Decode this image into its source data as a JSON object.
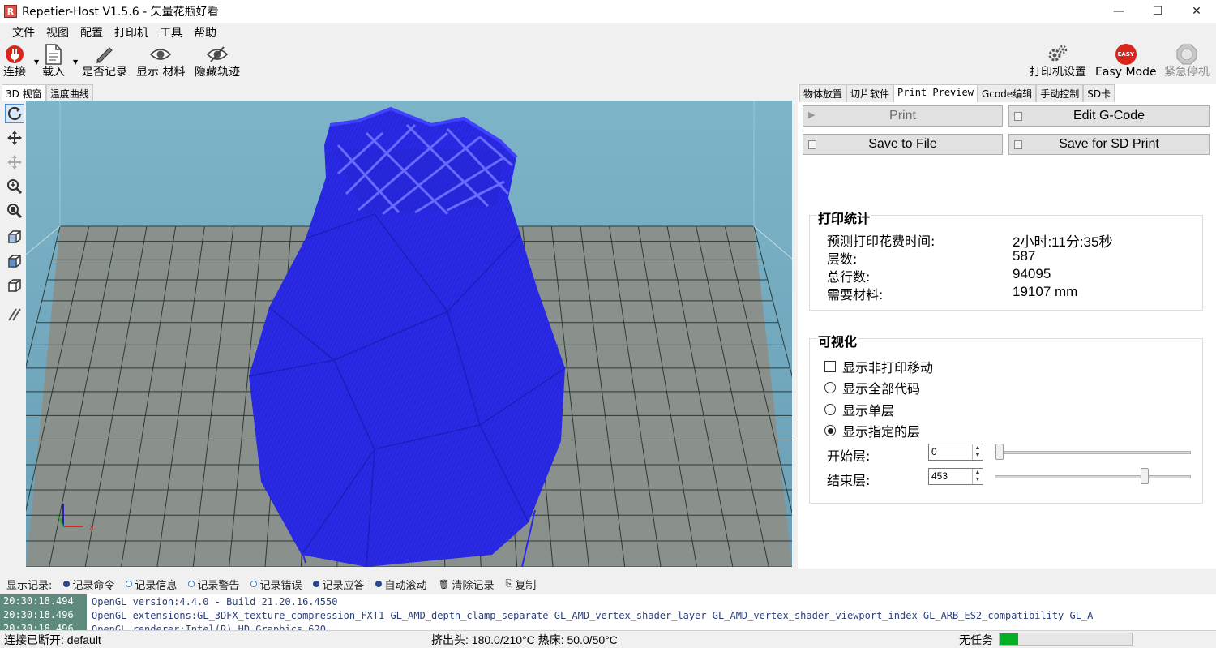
{
  "window": {
    "title": "Repetier-Host V1.5.6 - 矢量花瓶好看",
    "app_icon": "R",
    "controls": {
      "minimize": "—",
      "maximize": "☐",
      "close": "✕"
    }
  },
  "menu": [
    "文件",
    "视图",
    "配置",
    "打印机",
    "工具",
    "帮助"
  ],
  "toolbar": {
    "connect": "连接",
    "load": "载入",
    "log_toggle": "是否记录",
    "show_material": "显示 材料",
    "hide_travel": "隐藏轨迹",
    "printer_settings": "打印机设置",
    "easy_mode": "Easy Mode",
    "easy_badge": "EASY",
    "emergency_stop": "紧急停机"
  },
  "left_tabs": [
    "3D 视窗",
    "温度曲线"
  ],
  "right_tabs": [
    "物体放置",
    "切片软件",
    "Print Preview",
    "Gcode编辑",
    "手动控制",
    "SD卡"
  ],
  "preview": {
    "print_btn": "Print",
    "edit_gcode_btn": "Edit G-Code",
    "save_file_btn": "Save to File",
    "save_sd_btn": "Save for SD Print",
    "stats": {
      "title": "打印统计",
      "time_label": "预测打印花费时间:",
      "time_value": "2小时:11分:35秒",
      "layers_label": "层数:",
      "layers_value": "587",
      "lines_label": "总行数:",
      "lines_value": "94095",
      "material_label": "需要材料:",
      "material_value": "19107 mm"
    },
    "visual": {
      "title": "可视化",
      "show_travel": "显示非打印移动",
      "show_all": "显示全部代码",
      "show_single": "显示单层",
      "show_range": "显示指定的层",
      "start_label": "开始层:",
      "start_value": "0",
      "end_label": "结束层:",
      "end_value": "453",
      "end_fraction": 0.77
    }
  },
  "log": {
    "label": "显示记录:",
    "options": [
      "记录命令",
      "记录信息",
      "记录警告",
      "记录错误",
      "记录应答",
      "自动滚动"
    ],
    "clear": "清除记录",
    "copy": "复制",
    "rows": [
      {
        "time": "20:30:18.494",
        "msg": "OpenGL version:4.4.0 - Build 21.20.16.4550"
      },
      {
        "time": "20:30:18.496",
        "msg": "OpenGL extensions:GL_3DFX_texture_compression_FXT1 GL_AMD_depth_clamp_separate GL_AMD_vertex_shader_layer GL_AMD_vertex_shader_viewport_index GL_ARB_ES2_compatibility GL_A"
      },
      {
        "time": "20:30:18.496",
        "msg": "OpenGL renderer:Intel(R) HD Graphics 620"
      }
    ]
  },
  "status": {
    "connection": "连接已断开: default",
    "temps": "挤出头: 180.0/210°C 热床: 50.0/50°C",
    "job": "无任务",
    "progress": 0.14
  },
  "colors": {
    "viewport_bg": "#6fa4ba",
    "bed": "#8a918d",
    "model": "#2a2ae6",
    "progress": "#06b025"
  }
}
